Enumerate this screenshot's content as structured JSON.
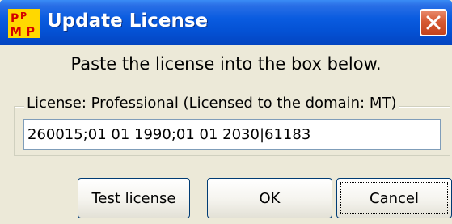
{
  "window": {
    "title": "Update License",
    "app_icon": "mpp-app-icon",
    "close_icon": "close-icon"
  },
  "instruction": "Paste the license into the box below.",
  "license_group": {
    "label": "License: Professional (Licensed to the domain: MT)",
    "value": "260015;01 01 1990;01 01 2030|61183"
  },
  "buttons": {
    "test_license": "Test license",
    "ok": "OK",
    "cancel": "Cancel"
  },
  "colors": {
    "titlebar": "#0451d4",
    "close_button": "#d65a33",
    "dialog_background": "#ece9d8"
  }
}
